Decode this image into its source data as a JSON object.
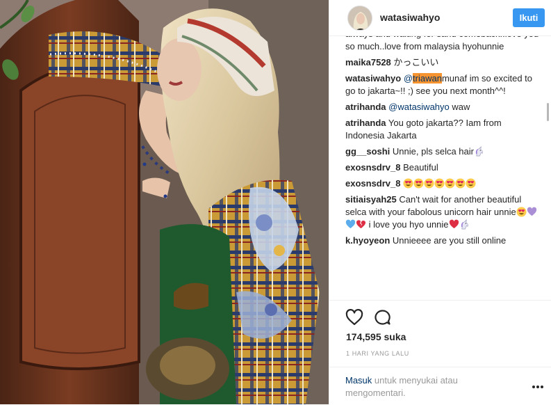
{
  "post": {
    "username": "watasiwahyo",
    "follow_label": "Ikuti",
    "likes": "174,595 suka",
    "time": "1 HARI YANG LALU"
  },
  "comments": [
    {
      "text_a": "always and waiting for sand comeback..love you so much..love from malaysia hyohunnie"
    },
    {
      "user": "maika7528",
      "text_a": "かっこいい"
    },
    {
      "user": "watasiwahyo",
      "mention_pre": "@",
      "mention_hl": "triawan",
      "mention_post": "munaf",
      "text_a": " im so excited to go to jakarta~!! ;) see you next month^^!"
    },
    {
      "user": "atrihanda",
      "mention": "@watasiwahyo",
      "text_a": " waw"
    },
    {
      "user": "atrihanda",
      "text_a": "You goto jakarta?? Iam from Indonesia Jakarta"
    },
    {
      "user": "gg__soshi",
      "text_a": "Unnie, pls selca hair"
    },
    {
      "user": "exosnsdrv_8",
      "text_a": "Beautiful"
    },
    {
      "user": "exosnsdrv_8"
    },
    {
      "user": "sitiaisyah25",
      "text_a": "Can't wait for another beautiful selca with your fabolous unicorn hair unnie",
      "text_b": " i love you hyo unnie"
    },
    {
      "user": "k.hyoyeon",
      "text_a": "Unnieeee are you still online"
    }
  ],
  "footer": {
    "login_link": "Masuk",
    "login_rest": " untuk menyukai atau mengomentari."
  },
  "icons": {
    "like": "heart-outline-icon",
    "comment": "speech-bubble-icon",
    "more": "ellipsis-icon",
    "emoji_heart_eyes": "heart-eyes-emoji",
    "emoji_unicorn": "unicorn-emoji"
  },
  "colors": {
    "accent": "#3897f0",
    "mention": "#003569",
    "highlight": "#f7942f",
    "muted": "#999999"
  }
}
